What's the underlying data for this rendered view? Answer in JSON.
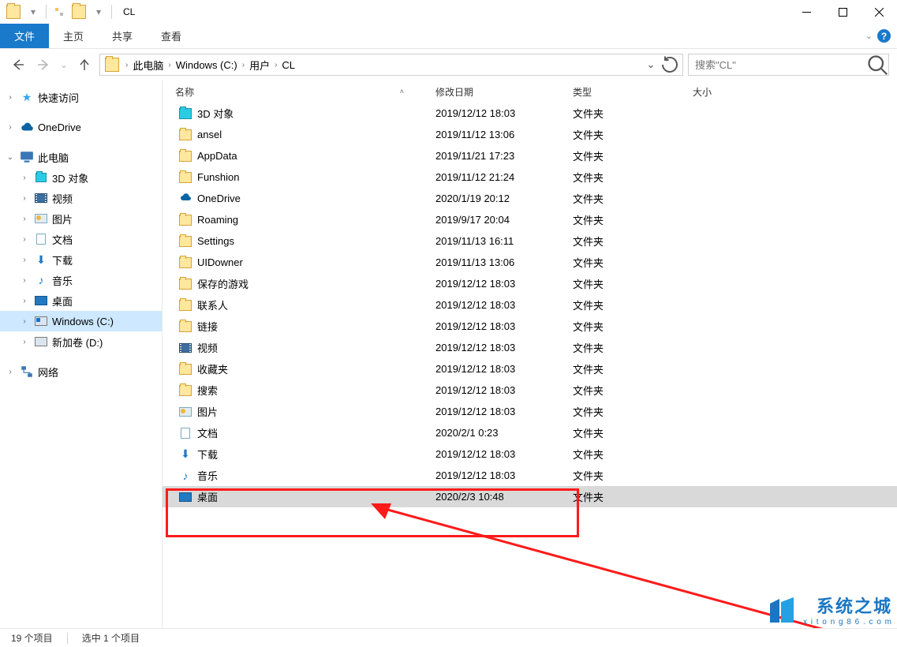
{
  "title": "CL",
  "qat": {
    "folder_tip": "folder"
  },
  "ribbon": {
    "file": "文件",
    "home": "主页",
    "share": "共享",
    "view": "查看"
  },
  "nav": {
    "crumbs": [
      "此电脑",
      "Windows (C:)",
      "用户",
      "CL"
    ]
  },
  "search": {
    "placeholder": "搜索\"CL\""
  },
  "sidebar": {
    "quick_access": "快速访问",
    "onedrive": "OneDrive",
    "this_pc": "此电脑",
    "items": [
      {
        "label": "3D 对象",
        "icon": "3d"
      },
      {
        "label": "视频",
        "icon": "vid"
      },
      {
        "label": "图片",
        "icon": "img"
      },
      {
        "label": "文档",
        "icon": "doc"
      },
      {
        "label": "下载",
        "icon": "down"
      },
      {
        "label": "音乐",
        "icon": "music"
      },
      {
        "label": "桌面",
        "icon": "desktop"
      },
      {
        "label": "Windows (C:)",
        "icon": "diskwin",
        "selected": true
      },
      {
        "label": "新加卷 (D:)",
        "icon": "disk"
      }
    ],
    "network": "网络"
  },
  "columns": {
    "name": "名称",
    "date": "修改日期",
    "type": "类型",
    "size": "大小"
  },
  "files": [
    {
      "name": "3D 对象",
      "date": "2019/12/12 18:03",
      "type": "文件夹",
      "icon": "folder-cyan"
    },
    {
      "name": "ansel",
      "date": "2019/11/12 13:06",
      "type": "文件夹",
      "icon": "folder"
    },
    {
      "name": "AppData",
      "date": "2019/11/21 17:23",
      "type": "文件夹",
      "icon": "folder"
    },
    {
      "name": "Funshion",
      "date": "2019/11/12 21:24",
      "type": "文件夹",
      "icon": "folder"
    },
    {
      "name": "OneDrive",
      "date": "2020/1/19 20:12",
      "type": "文件夹",
      "icon": "cloud"
    },
    {
      "name": "Roaming",
      "date": "2019/9/17 20:04",
      "type": "文件夹",
      "icon": "folder"
    },
    {
      "name": "Settings",
      "date": "2019/11/13 16:11",
      "type": "文件夹",
      "icon": "folder"
    },
    {
      "name": "UIDowner",
      "date": "2019/11/13 13:06",
      "type": "文件夹",
      "icon": "folder"
    },
    {
      "name": "保存的游戏",
      "date": "2019/12/12 18:03",
      "type": "文件夹",
      "icon": "folder"
    },
    {
      "name": "联系人",
      "date": "2019/12/12 18:03",
      "type": "文件夹",
      "icon": "folder"
    },
    {
      "name": "链接",
      "date": "2019/12/12 18:03",
      "type": "文件夹",
      "icon": "folder"
    },
    {
      "name": "视频",
      "date": "2019/12/12 18:03",
      "type": "文件夹",
      "icon": "vid"
    },
    {
      "name": "收藏夹",
      "date": "2019/12/12 18:03",
      "type": "文件夹",
      "icon": "folder"
    },
    {
      "name": "搜索",
      "date": "2019/12/12 18:03",
      "type": "文件夹",
      "icon": "folder"
    },
    {
      "name": "图片",
      "date": "2019/12/12 18:03",
      "type": "文件夹",
      "icon": "img"
    },
    {
      "name": "文档",
      "date": "2020/2/1 0:23",
      "type": "文件夹",
      "icon": "doc"
    },
    {
      "name": "下载",
      "date": "2019/12/12 18:03",
      "type": "文件夹",
      "icon": "down"
    },
    {
      "name": "音乐",
      "date": "2019/12/12 18:03",
      "type": "文件夹",
      "icon": "music"
    },
    {
      "name": "桌面",
      "date": "2020/2/3 10:48",
      "type": "文件夹",
      "icon": "desktop",
      "selected": true
    }
  ],
  "status": {
    "count": "19 个项目",
    "selected": "选中 1 个项目"
  },
  "watermark": {
    "line1": "系统之城",
    "line2": "x i t o n g 8 6 . c o m"
  }
}
